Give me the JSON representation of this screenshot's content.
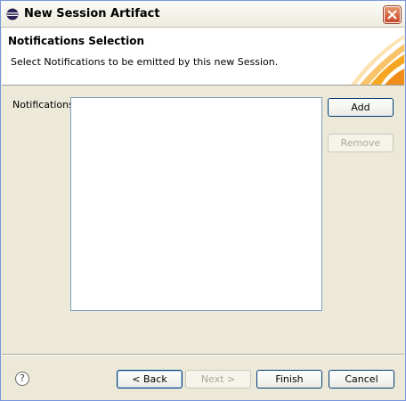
{
  "window": {
    "title": "New Session Artifact"
  },
  "header": {
    "title": "Notifications Selection",
    "description": "Select Notifications to be emitted by this new Session."
  },
  "notifications": {
    "label": "Notifications",
    "items": []
  },
  "buttons": {
    "add": "Add",
    "remove": "Remove",
    "back": "< Back",
    "next": "Next >",
    "finish": "Finish",
    "cancel": "Cancel"
  },
  "help": {
    "glyph": "?"
  },
  "colors": {
    "accent": "#f5a623",
    "title_close": "#c8472a",
    "border_blue": "#003c74"
  }
}
